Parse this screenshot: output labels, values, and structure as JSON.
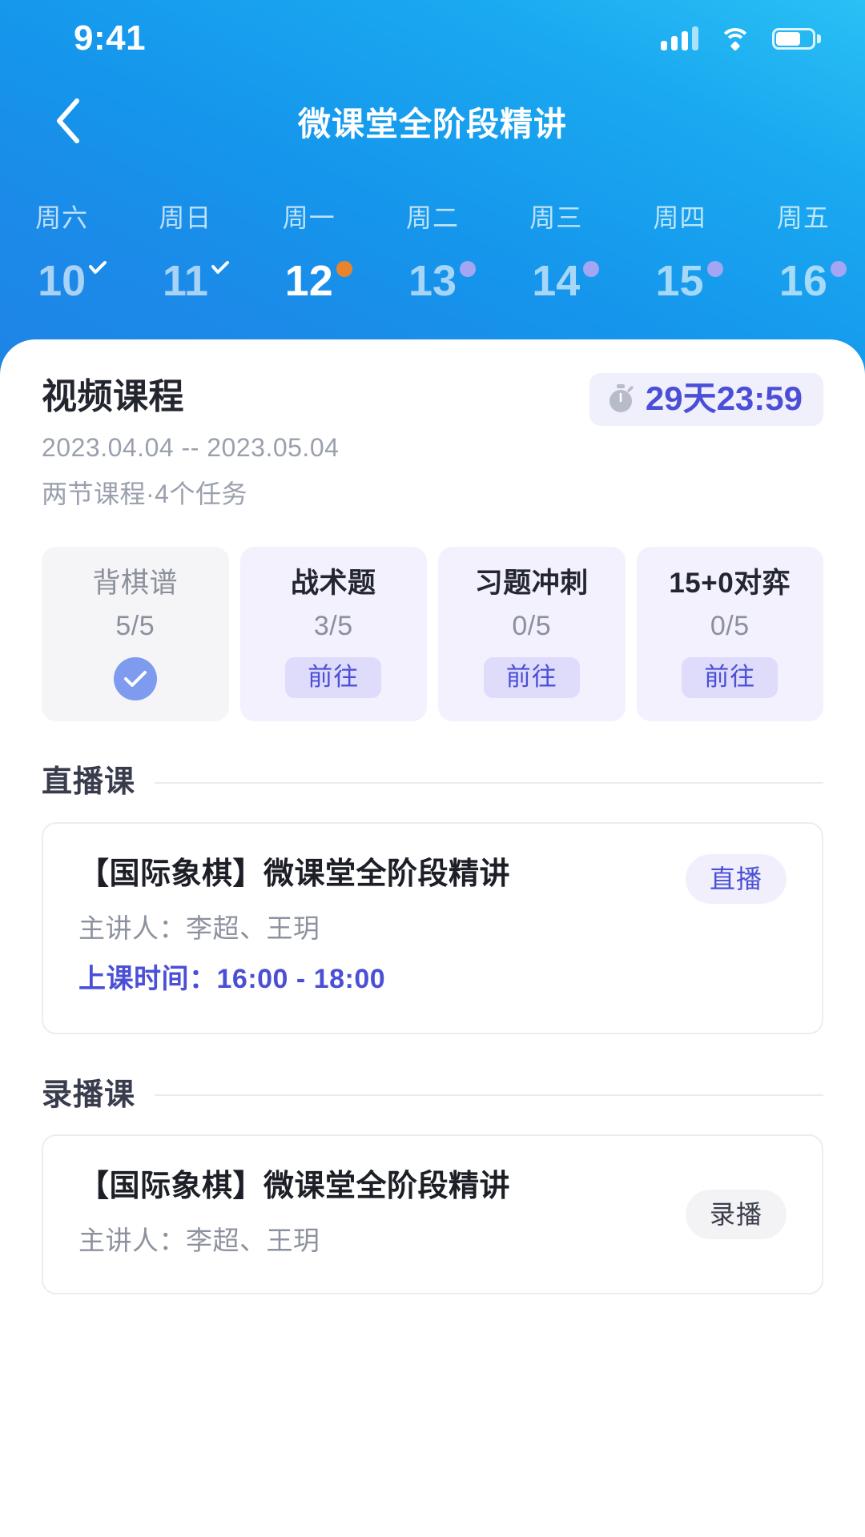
{
  "status_bar": {
    "time": "9:41",
    "icons": [
      "signal-icon",
      "wifi-icon",
      "battery-icon"
    ]
  },
  "nav": {
    "back_icon": "chevron-left-icon",
    "title": "微课堂全阶段精讲"
  },
  "week_strip": {
    "days": [
      {
        "dow": "周六",
        "num": "10",
        "mark": "check",
        "active": false
      },
      {
        "dow": "周日",
        "num": "11",
        "mark": "check",
        "active": false
      },
      {
        "dow": "周一",
        "num": "12",
        "mark": "dot-orange",
        "active": true
      },
      {
        "dow": "周二",
        "num": "13",
        "mark": "dot-lavender",
        "active": false
      },
      {
        "dow": "周三",
        "num": "14",
        "mark": "dot-lavender",
        "active": false
      },
      {
        "dow": "周四",
        "num": "15",
        "mark": "dot-lavender",
        "active": false
      },
      {
        "dow": "周五",
        "num": "16",
        "mark": "dot-lavender",
        "active": false
      }
    ]
  },
  "summary": {
    "title": "视频课程",
    "dates": "2023.04.04 -- 2023.05.04",
    "meta": "两节课程·4个任务",
    "countdown": {
      "icon": "stopwatch-icon",
      "text": "29天23:59"
    }
  },
  "tasks": [
    {
      "name": "背棋谱",
      "progress": "5/5",
      "state": "done",
      "action_label": "",
      "badge_icon": "check-circle-icon"
    },
    {
      "name": "战术题",
      "progress": "3/5",
      "state": "todo",
      "action_label": "前往",
      "badge_icon": ""
    },
    {
      "name": "习题冲刺",
      "progress": "0/5",
      "state": "todo",
      "action_label": "前往",
      "badge_icon": ""
    },
    {
      "name": "15+0对弈",
      "progress": "0/5",
      "state": "todo",
      "action_label": "前往",
      "badge_icon": ""
    }
  ],
  "sections": [
    {
      "title": "直播课",
      "lesson": {
        "title": "【国际象棋】微课堂全阶段精讲",
        "teacher": "主讲人：李超、王玥",
        "time": "上课时间：16:00 - 18:00",
        "badge": "直播",
        "badge_style": "live"
      }
    },
    {
      "title": "录播课",
      "lesson": {
        "title": "【国际象棋】微课堂全阶段精讲",
        "teacher": "主讲人：李超、王玥",
        "time": "",
        "badge": "录播",
        "badge_style": "replay"
      }
    }
  ],
  "colors": {
    "hero_gradient_start": "#2ac0f5",
    "hero_gradient_end": "#1f84e6",
    "accent_indigo": "#4b4fd6",
    "accent_orange": "#e8852c",
    "dot_lavender": "#a3a6f2",
    "chip_lavender_bg": "#dedcfa",
    "card_todo_bg": "#f2f1fd",
    "card_done_bg": "#f5f5f7",
    "check_circle": "#7e9bf0"
  }
}
